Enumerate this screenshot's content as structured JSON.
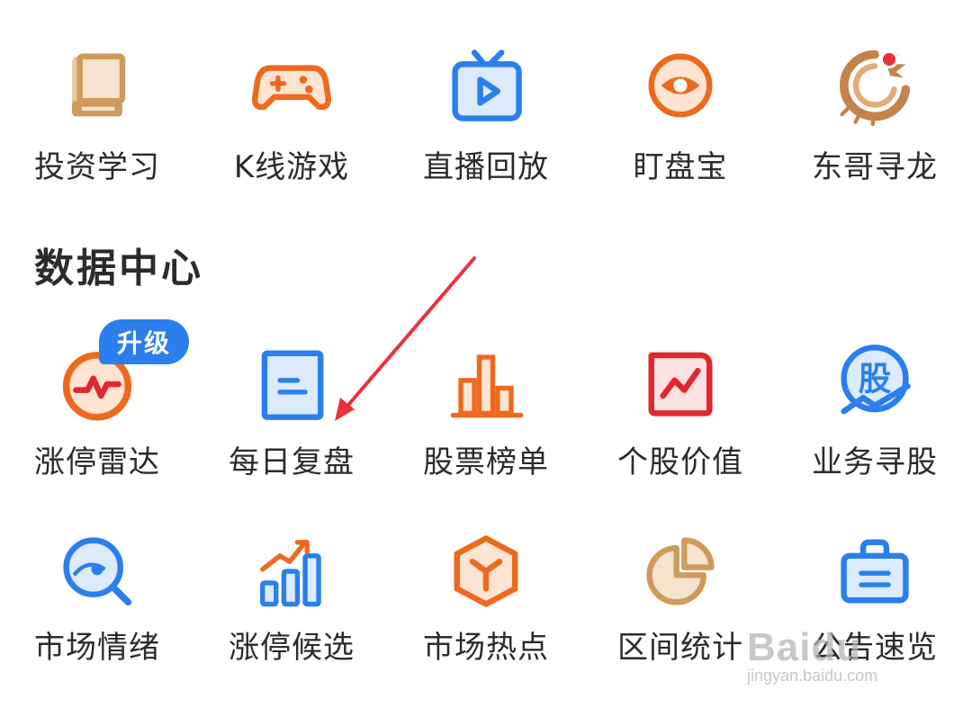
{
  "colors": {
    "blue": "#2a7fec",
    "orange": "#ec6a1d",
    "red": "#e0272e",
    "tan": "#d09a5c",
    "brown": "#c3834a"
  },
  "row1": [
    {
      "label": "投资学习",
      "icon": "book-icon"
    },
    {
      "label": "K线游戏",
      "icon": "gamepad-icon"
    },
    {
      "label": "直播回放",
      "icon": "tv-play-icon"
    },
    {
      "label": "盯盘宝",
      "icon": "eye-icon"
    },
    {
      "label": "东哥寻龙",
      "icon": "dragon-icon"
    }
  ],
  "section": {
    "title": "数据中心"
  },
  "badge": {
    "text": "升级"
  },
  "row2": [
    {
      "label": "涨停雷达",
      "icon": "radar-pulse-icon"
    },
    {
      "label": "每日复盘",
      "icon": "document-icon"
    },
    {
      "label": "股票榜单",
      "icon": "bar-chart-icon"
    },
    {
      "label": "个股价值",
      "icon": "trend-chart-icon"
    },
    {
      "label": "业务寻股",
      "icon": "stock-search-icon"
    }
  ],
  "row3": [
    {
      "label": "市场情绪",
      "icon": "magnifier-icon"
    },
    {
      "label": "涨停候选",
      "icon": "rising-bars-icon"
    },
    {
      "label": "市场热点",
      "icon": "cube-icon"
    },
    {
      "label": "区间统计",
      "icon": "pie-chart-icon"
    },
    {
      "label": "公告速览",
      "icon": "briefcase-icon"
    }
  ],
  "watermark": {
    "main": "Baidu",
    "sub": "jingyan.baidu.com"
  }
}
